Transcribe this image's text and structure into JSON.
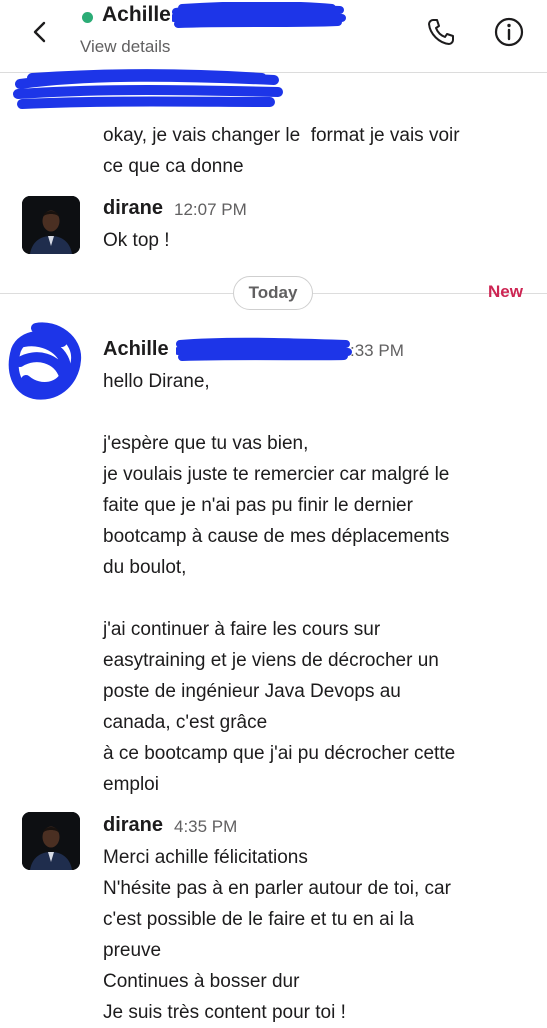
{
  "header": {
    "name": "Achille",
    "view_details": "View details",
    "back_icon": "chevron-left-icon",
    "call_icon": "phone-icon",
    "info_icon": "info-icon",
    "presence_color": "#2bac76"
  },
  "messages": {
    "m0": {
      "text": "okay, je vais changer le  format je vais voir\nce que ca donne"
    },
    "m1": {
      "author": "dirane",
      "time": "12:07 PM",
      "text": "Ok top !"
    },
    "m2": {
      "author": "Achille",
      "time": ":33 PM",
      "text": "hello Dirane,\n\nj'espère que tu vas bien,\nje voulais juste te remercier car malgré le\nfaite que je n'ai pas pu finir le dernier\nbootcamp à cause de mes déplacements\ndu boulot,\n\nj'ai continuer à faire les cours sur\neasytraining et je viens de décrocher un\nposte de ingénieur Java Devops au\ncanada, c'est grâce\nà ce bootcamp que j'ai pu décrocher cette\nemploi"
    },
    "m3": {
      "author": "dirane",
      "time": "4:35 PM",
      "text": "Merci achille félicitations\nN'hésite pas à en parler autour de toi, car\nc'est possible de le faire et tu en ai la\npreuve\nContinues à bosser dur\nJe suis très content pour toi !"
    }
  },
  "divider": {
    "today_label": "Today",
    "new_label": "New",
    "new_color": "#cd2553"
  },
  "colors": {
    "redaction": "#1d35e8"
  }
}
